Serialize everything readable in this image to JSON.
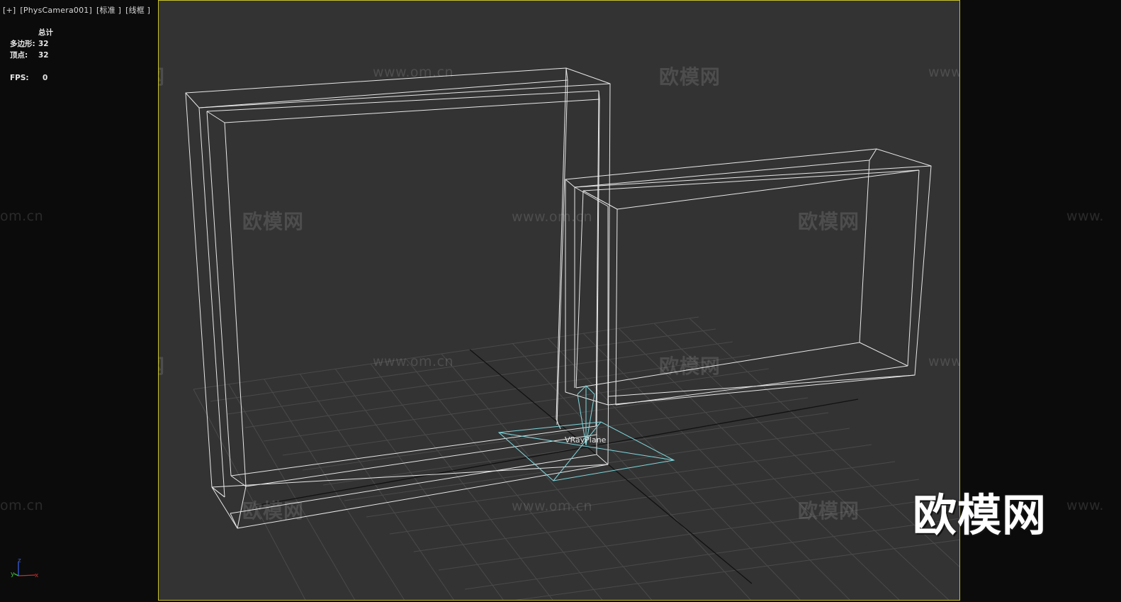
{
  "viewport_label": {
    "plus": "[+]",
    "camera": "[PhysCamera001]",
    "shading": "[标准 ]",
    "mode": "[线框 ]"
  },
  "stats": {
    "header": "总计",
    "polygons_label": "多边形:",
    "polygons_value": "32",
    "vertices_label": "顶点:",
    "vertices_value": "32",
    "fps_label": "FPS:",
    "fps_value": "0"
  },
  "scene": {
    "object_label": "VRayPlane",
    "wireframe_color": "#e8e8e8",
    "plane_color": "#7fd8de",
    "grid_color": "#4a4a4a",
    "axis_line_color": "#111111"
  },
  "axis_tripod": {
    "z": "z",
    "x": "x",
    "y": "y"
  },
  "colors": {
    "viewport_bg": "#333333",
    "side_bg": "#0b0b0b",
    "active_border": "#c8c229"
  },
  "watermarks": {
    "cn": "欧模网",
    "url": "www.om.cn",
    "url_partial_left": "om.cn",
    "url_partial_right": "www."
  },
  "logo": "欧模网"
}
